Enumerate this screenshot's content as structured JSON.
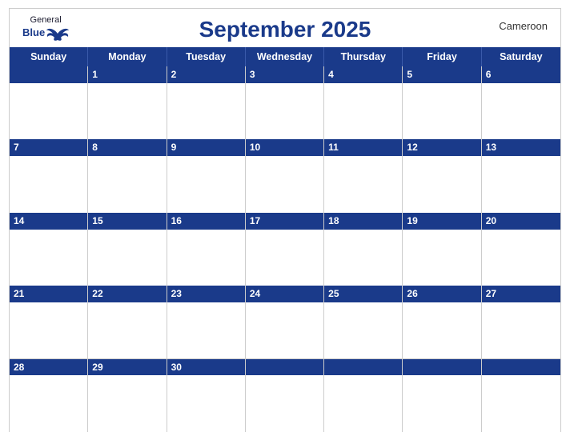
{
  "header": {
    "logo": {
      "general": "General",
      "blue": "Blue",
      "bird_unicode": "🐦"
    },
    "title": "September 2025",
    "country": "Cameroon"
  },
  "day_headers": [
    "Sunday",
    "Monday",
    "Tuesday",
    "Wednesday",
    "Thursday",
    "Friday",
    "Saturday"
  ],
  "weeks": [
    [
      {
        "day": "",
        "empty": true
      },
      {
        "day": "1"
      },
      {
        "day": "2"
      },
      {
        "day": "3"
      },
      {
        "day": "4"
      },
      {
        "day": "5"
      },
      {
        "day": "6"
      }
    ],
    [
      {
        "day": "7"
      },
      {
        "day": "8"
      },
      {
        "day": "9"
      },
      {
        "day": "10"
      },
      {
        "day": "11"
      },
      {
        "day": "12"
      },
      {
        "day": "13"
      }
    ],
    [
      {
        "day": "14"
      },
      {
        "day": "15"
      },
      {
        "day": "16"
      },
      {
        "day": "17"
      },
      {
        "day": "18"
      },
      {
        "day": "19"
      },
      {
        "day": "20"
      }
    ],
    [
      {
        "day": "21"
      },
      {
        "day": "22"
      },
      {
        "day": "23"
      },
      {
        "day": "24"
      },
      {
        "day": "25"
      },
      {
        "day": "26"
      },
      {
        "day": "27"
      }
    ],
    [
      {
        "day": "28"
      },
      {
        "day": "29"
      },
      {
        "day": "30"
      },
      {
        "day": "",
        "empty": true
      },
      {
        "day": "",
        "empty": true
      },
      {
        "day": "",
        "empty": true
      },
      {
        "day": "",
        "empty": true
      }
    ]
  ]
}
